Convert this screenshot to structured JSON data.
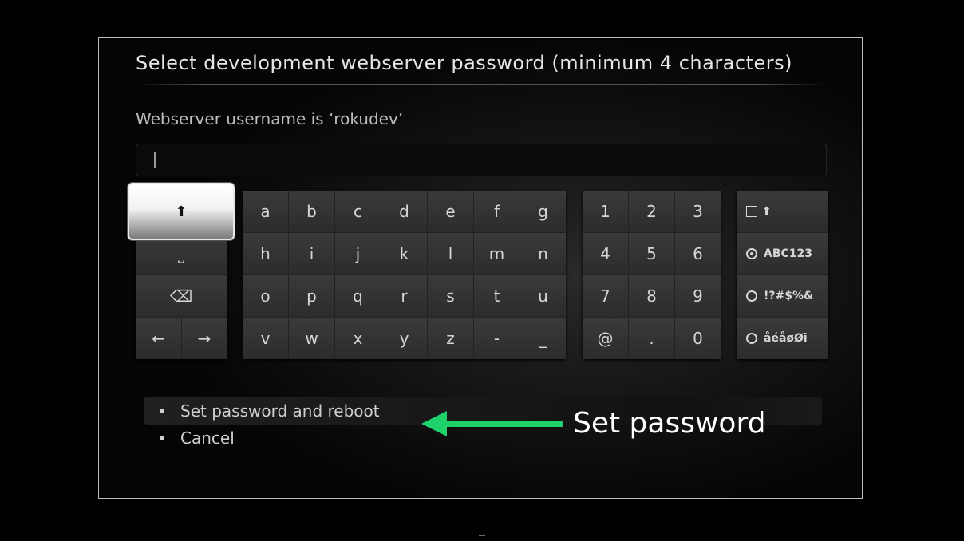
{
  "dialog": {
    "title": "Select development webserver password (minimum 4 characters)",
    "subtitle": "Webserver username is ‘rokudev’",
    "input_value": ""
  },
  "keyboard": {
    "left_keys": [
      {
        "label": "⬆",
        "icon": "shift-icon"
      },
      {
        "label": "⎵",
        "icon": "space-icon"
      },
      {
        "label": "⌫",
        "icon": "backspace-icon"
      },
      {
        "label": "←",
        "icon": "cursor-left-icon"
      },
      {
        "label": "→",
        "icon": "cursor-right-icon"
      }
    ],
    "alpha_keys": [
      "a",
      "b",
      "c",
      "d",
      "e",
      "f",
      "g",
      "h",
      "i",
      "j",
      "k",
      "l",
      "m",
      "n",
      "o",
      "p",
      "q",
      "r",
      "s",
      "t",
      "u",
      "v",
      "w",
      "x",
      "y",
      "z",
      "-",
      "_"
    ],
    "num_keys": [
      "1",
      "2",
      "3",
      "4",
      "5",
      "6",
      "7",
      "8",
      "9",
      "@",
      ".",
      "0"
    ],
    "modes": [
      {
        "label": "⬆",
        "kind": "checkbox"
      },
      {
        "label": "ABC123",
        "kind": "radio",
        "selected": true
      },
      {
        "label": "!?#$%&",
        "kind": "radio",
        "selected": false
      },
      {
        "label": "åéåøØi",
        "kind": "radio",
        "selected": false
      }
    ]
  },
  "options": [
    {
      "label": "Set password and reboot",
      "selected": true
    },
    {
      "label": "Cancel",
      "selected": false
    }
  ],
  "annotation": {
    "label": "Set password",
    "color": "#1fd16a"
  }
}
